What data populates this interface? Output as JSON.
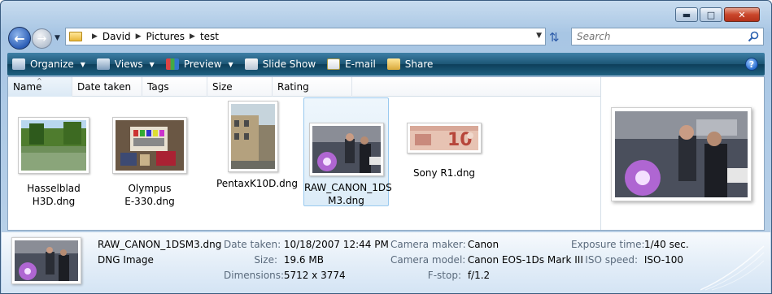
{
  "colors": {
    "accent": "#1c5675",
    "selection": "#99c9ef"
  },
  "window": {
    "caption_buttons": {
      "minimize": "minimize-icon",
      "maximize": "maximize-icon",
      "close": "close-icon"
    }
  },
  "address_bar": {
    "crumbs": [
      "David",
      "Pictures",
      "test"
    ]
  },
  "search": {
    "placeholder": "Search"
  },
  "toolbar": {
    "organize": "Organize",
    "views": "Views",
    "preview": "Preview",
    "slideshow": "Slide Show",
    "email": "E-mail",
    "share": "Share"
  },
  "columns": [
    "Name",
    "Date taken",
    "Tags",
    "Size",
    "Rating"
  ],
  "files": [
    {
      "line1": "Hasselblad",
      "line2": "H3D.dng"
    },
    {
      "line1": "Olympus",
      "line2": "E-330.dng"
    },
    {
      "line1": "PentaxK10D.dng",
      "line2": ""
    },
    {
      "line1": "RAW_CANON_1DS",
      "line2": "M3.dng"
    },
    {
      "line1": "Sony R1.dng",
      "line2": ""
    }
  ],
  "details": {
    "filename": "RAW_CANON_1DSM3.dng",
    "filetype": "DNG Image",
    "props": {
      "date_taken_label": "Date taken:",
      "date_taken": "10/18/2007 12:44 PM",
      "size_label": "Size:",
      "size": "19.6 MB",
      "dimensions_label": "Dimensions:",
      "dimensions": "5712 x 3774",
      "camera_maker_label": "Camera maker:",
      "camera_maker": "Canon",
      "camera_model_label": "Camera model:",
      "camera_model": "Canon EOS-1Ds Mark III",
      "fstop_label": "F-stop:",
      "fstop": "f/1.2",
      "exposure_label": "Exposure time:",
      "exposure": "1/40 sec.",
      "iso_label": "ISO speed:",
      "iso": "ISO-100"
    }
  }
}
